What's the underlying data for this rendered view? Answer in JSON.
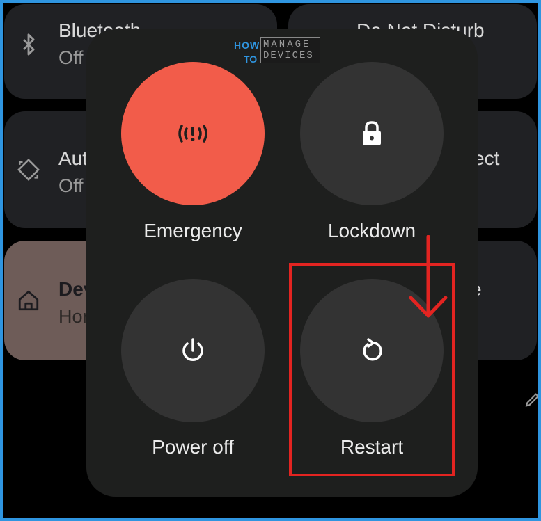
{
  "quick_tiles": {
    "bluetooth": {
      "title": "Bluetooth",
      "state": "Off",
      "icon": "bluetooth-icon"
    },
    "do_not_disturb": {
      "title": "Do Not Disturb",
      "icon": "do-not-disturb-icon"
    },
    "auto_rotate": {
      "title": "Auto",
      "state": "Off",
      "icon": "auto-rotate-icon"
    },
    "right_middle": {
      "title": "ect"
    },
    "device_controls": {
      "title": "Dev",
      "state": "Hor",
      "icon": "home-icon"
    },
    "right_lower": {
      "title": "e"
    }
  },
  "logo": {
    "how": "HOW",
    "to": "TO",
    "manage": "MANAGE",
    "devices": "DEVICES"
  },
  "power_menu": {
    "buttons": [
      {
        "label": "Emergency",
        "icon": "emergency-icon",
        "color": "#f25c4a"
      },
      {
        "label": "Lockdown",
        "icon": "lock-icon",
        "color": "#333333"
      },
      {
        "label": "Power off",
        "icon": "power-icon",
        "color": "#333333"
      },
      {
        "label": "Restart",
        "icon": "restart-icon",
        "color": "#333333"
      }
    ]
  },
  "annotation": {
    "highlight_color": "#e32421",
    "frame_color": "#2f95e0"
  }
}
